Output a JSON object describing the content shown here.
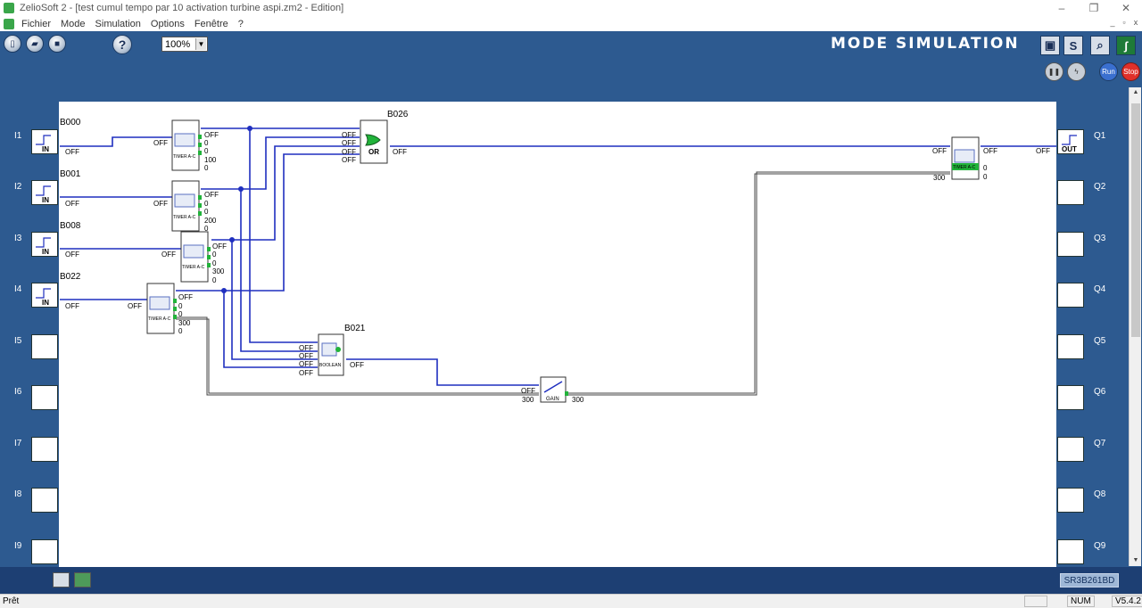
{
  "window": {
    "title": "ZelioSoft 2 - [test cumul tempo par 10 activation turbine aspi.zm2 - Edition]",
    "min": "–",
    "max": "❐",
    "close": "✕"
  },
  "menu": {
    "items": [
      "Fichier",
      "Mode",
      "Simulation",
      "Options",
      "Fenêtre",
      "?"
    ],
    "mdi_min": "_",
    "mdi_max": "▫",
    "mdi_close": "x"
  },
  "toolbar": {
    "zoom": "100%",
    "mode_title": "MODE SIMULATION",
    "s_label": "S",
    "run_label": "Run",
    "stop_label": "Stop",
    "help": "?"
  },
  "inputs": [
    {
      "label": "I1",
      "block": "IN",
      "block_id": "B000",
      "state": "OFF"
    },
    {
      "label": "I2",
      "block": "IN",
      "block_id": "B001",
      "state": "OFF"
    },
    {
      "label": "I3",
      "block": "IN",
      "block_id": "B008",
      "state": "OFF"
    },
    {
      "label": "I4",
      "block": "IN",
      "block_id": "B022",
      "state": "OFF"
    },
    {
      "label": "I5"
    },
    {
      "label": "I6"
    },
    {
      "label": "I7"
    },
    {
      "label": "I8"
    },
    {
      "label": "I9"
    }
  ],
  "outputs": [
    {
      "label": "Q1",
      "block": "OUT",
      "state": "OFF"
    },
    {
      "label": "Q2"
    },
    {
      "label": "Q3"
    },
    {
      "label": "Q4"
    },
    {
      "label": "Q5"
    },
    {
      "label": "Q6"
    },
    {
      "label": "Q7"
    },
    {
      "label": "Q8"
    },
    {
      "label": "Q9"
    }
  ],
  "timers": [
    {
      "name": "TIMER A-C",
      "in": "OFF",
      "outs": [
        "OFF",
        "0",
        "0",
        "100",
        "0"
      ]
    },
    {
      "name": "TIMER A-C",
      "in": "OFF",
      "outs": [
        "OFF",
        "0",
        "0",
        "200",
        "0"
      ]
    },
    {
      "name": "TIMER A-C",
      "in": "OFF",
      "outs": [
        "OFF",
        "0",
        "0",
        "300",
        "0"
      ]
    },
    {
      "name": "TIMER A-C",
      "in": "OFF",
      "outs": [
        "OFF",
        "0",
        "0",
        "300",
        "0"
      ]
    }
  ],
  "or_block": {
    "id": "B026",
    "label": "OR",
    "ins": [
      "OFF",
      "OFF",
      "OFF",
      "OFF"
    ],
    "out": "OFF"
  },
  "boolean_block": {
    "id": "B021",
    "label": "BOOLEAN",
    "ins": [
      "OFF",
      "OFF",
      "OFF",
      "OFF"
    ],
    "out": "OFF"
  },
  "gain_block": {
    "label": "GAIN",
    "in": "OFF",
    "in_val": "300",
    "out": "300"
  },
  "final_timer": {
    "name": "TIMER A-C",
    "in": "OFF",
    "in_val": "300",
    "outs": [
      "OFF",
      "0",
      "0"
    ],
    "q_state": "OFF"
  },
  "bottom": {
    "model": "SR3B261BD"
  },
  "status": {
    "ready": "Prêt",
    "num": "NUM",
    "version": "V5.4.2"
  },
  "colors": {
    "wire": "#1f2fbf",
    "panel": "#2d5a90",
    "dark": "#1d3f73",
    "green": "#21b33a"
  }
}
